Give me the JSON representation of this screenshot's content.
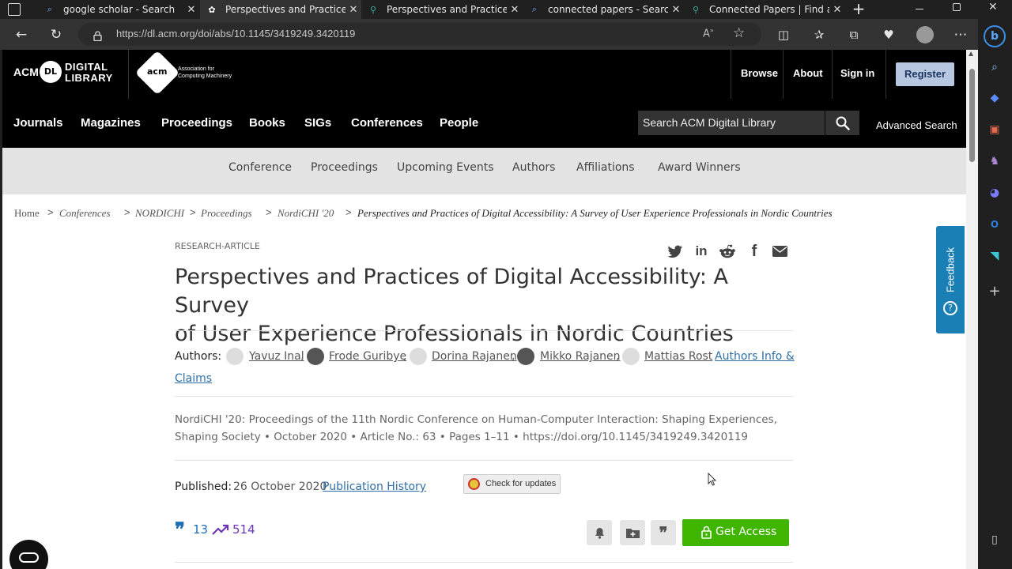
{
  "browser": {
    "tabs": [
      {
        "title": "google scholar - Search",
        "active": false
      },
      {
        "title": "Perspectives and Practices of",
        "active": true
      },
      {
        "title": "Perspectives and Practices of",
        "active": false
      },
      {
        "title": "connected papers - Search",
        "active": false
      },
      {
        "title": "Connected Papers | Find and",
        "active": false
      }
    ],
    "url": "https://dl.acm.org/doi/abs/10.1145/3419249.3420119"
  },
  "header": {
    "logo_acm": "ACM",
    "logo_dl": "DL",
    "logo_digital": "DIGITAL",
    "logo_library": "LIBRARY",
    "acm_badge": "acm",
    "assoc_line1": "Association for",
    "assoc_line2": "Computing Machinery",
    "top_links": [
      "Browse",
      "About",
      "Sign in"
    ],
    "register": "Register",
    "categories": [
      "Journals",
      "Magazines",
      "Proceedings",
      "Books",
      "SIGs",
      "Conferences",
      "People"
    ],
    "search_placeholder": "Search ACM Digital Library",
    "advanced_search": "Advanced Search"
  },
  "subnav": [
    "Conference",
    "Proceedings",
    "Upcoming Events",
    "Authors",
    "Affiliations",
    "Award Winners"
  ],
  "breadcrumb": [
    "Home",
    "Conferences",
    "NORDICHI",
    "Proceedings",
    "NordiCHI '20",
    "Perspectives and Practices of Digital Accessibility: A Survey of User Experience Professionals in Nordic Countries"
  ],
  "article": {
    "type": "RESEARCH-ARTICLE",
    "title_line1": "Perspectives and Practices of Digital Accessibility: A Survey",
    "title_line2": "of User Experience Professionals in Nordic Countries",
    "authors_label": "Authors:",
    "authors": [
      "Yavuz Inal",
      "Frode Guribye",
      "Dorina Rajanen",
      "Mikko Rajanen",
      "Mattias Rost"
    ],
    "authors_info_1": "Authors Info &",
    "authors_info_2": "Claims",
    "venue_line1": "NordiCHI '20: Proceedings of the 11th Nordic Conference on Human-Computer Interaction: Shaping Experiences,",
    "venue_line2": "Shaping Society • October 2020 • Article No.: 63 • Pages 1–11 • https://doi.org/10.1145/3419249.3420119",
    "published_label": "Published:",
    "published_date": "26 October 2020",
    "publication_history": "Publication History",
    "check_updates": "Check for updates",
    "citations": "13",
    "downloads": "514",
    "get_access": "Get Access"
  },
  "feedback": "Feedback",
  "colors": {
    "header_bg": "#000000",
    "register_bg": "#b7c7e0",
    "link_blue": "#2f6fa6",
    "get_access_green": "#3fb500",
    "feedback_blue": "#1a7fb5",
    "metric_blue": "#1f6fb3",
    "metric_purple": "#6b35b8"
  }
}
